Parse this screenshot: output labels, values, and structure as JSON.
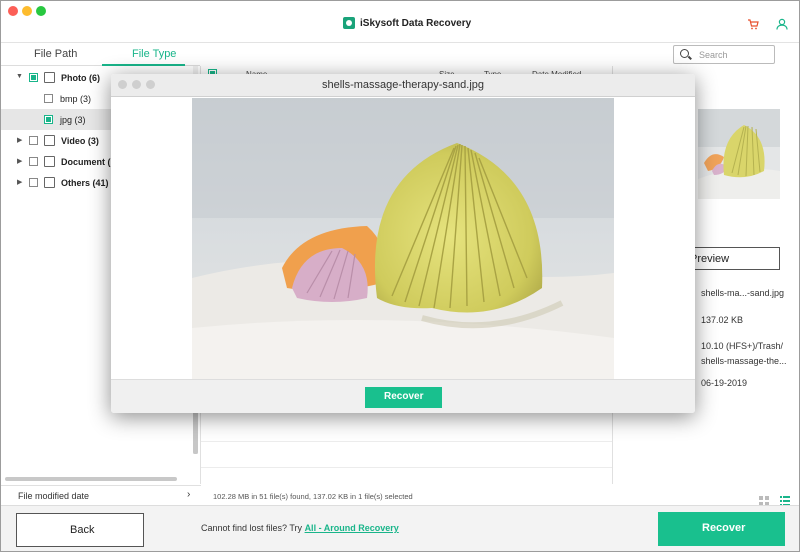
{
  "app": {
    "title": "iSkysoft Data Recovery"
  },
  "tabs": {
    "file_path": "File Path",
    "file_type": "File Type"
  },
  "search": {
    "placeholder": "Search"
  },
  "tree": {
    "photo": "Photo (6)",
    "bmp": "bmp (3)",
    "jpg": "jpg (3)",
    "video": "Video (3)",
    "document": "Document (",
    "others": "Others (41)"
  },
  "columns": {
    "name": "Name",
    "size": "Size",
    "type": "Type",
    "date": "Date Modified"
  },
  "sidebar_footer": {
    "label": "File modified date",
    "chevron": "›"
  },
  "details": {
    "preview_label": "Preview",
    "name": "shells-ma...-sand.jpg",
    "size": "137.02 KB",
    "path_line1": "10.10 (HFS+)/Trash/",
    "path_line2": "shells-massage-the...",
    "date": "06-19-2019"
  },
  "status": {
    "text": "102.28 MB in 51 file(s) found, 137.02 KB in 1 file(s) selected"
  },
  "footer": {
    "back": "Back",
    "msg_prefix": "Cannot find lost files? Try ",
    "msg_link": "All - Around Recovery",
    "recover": "Recover"
  },
  "modal": {
    "filename": "shells-massage-therapy-sand.jpg",
    "recover": "Recover"
  },
  "colors": {
    "accent": "#19c08e",
    "cart": "#e8512e"
  }
}
